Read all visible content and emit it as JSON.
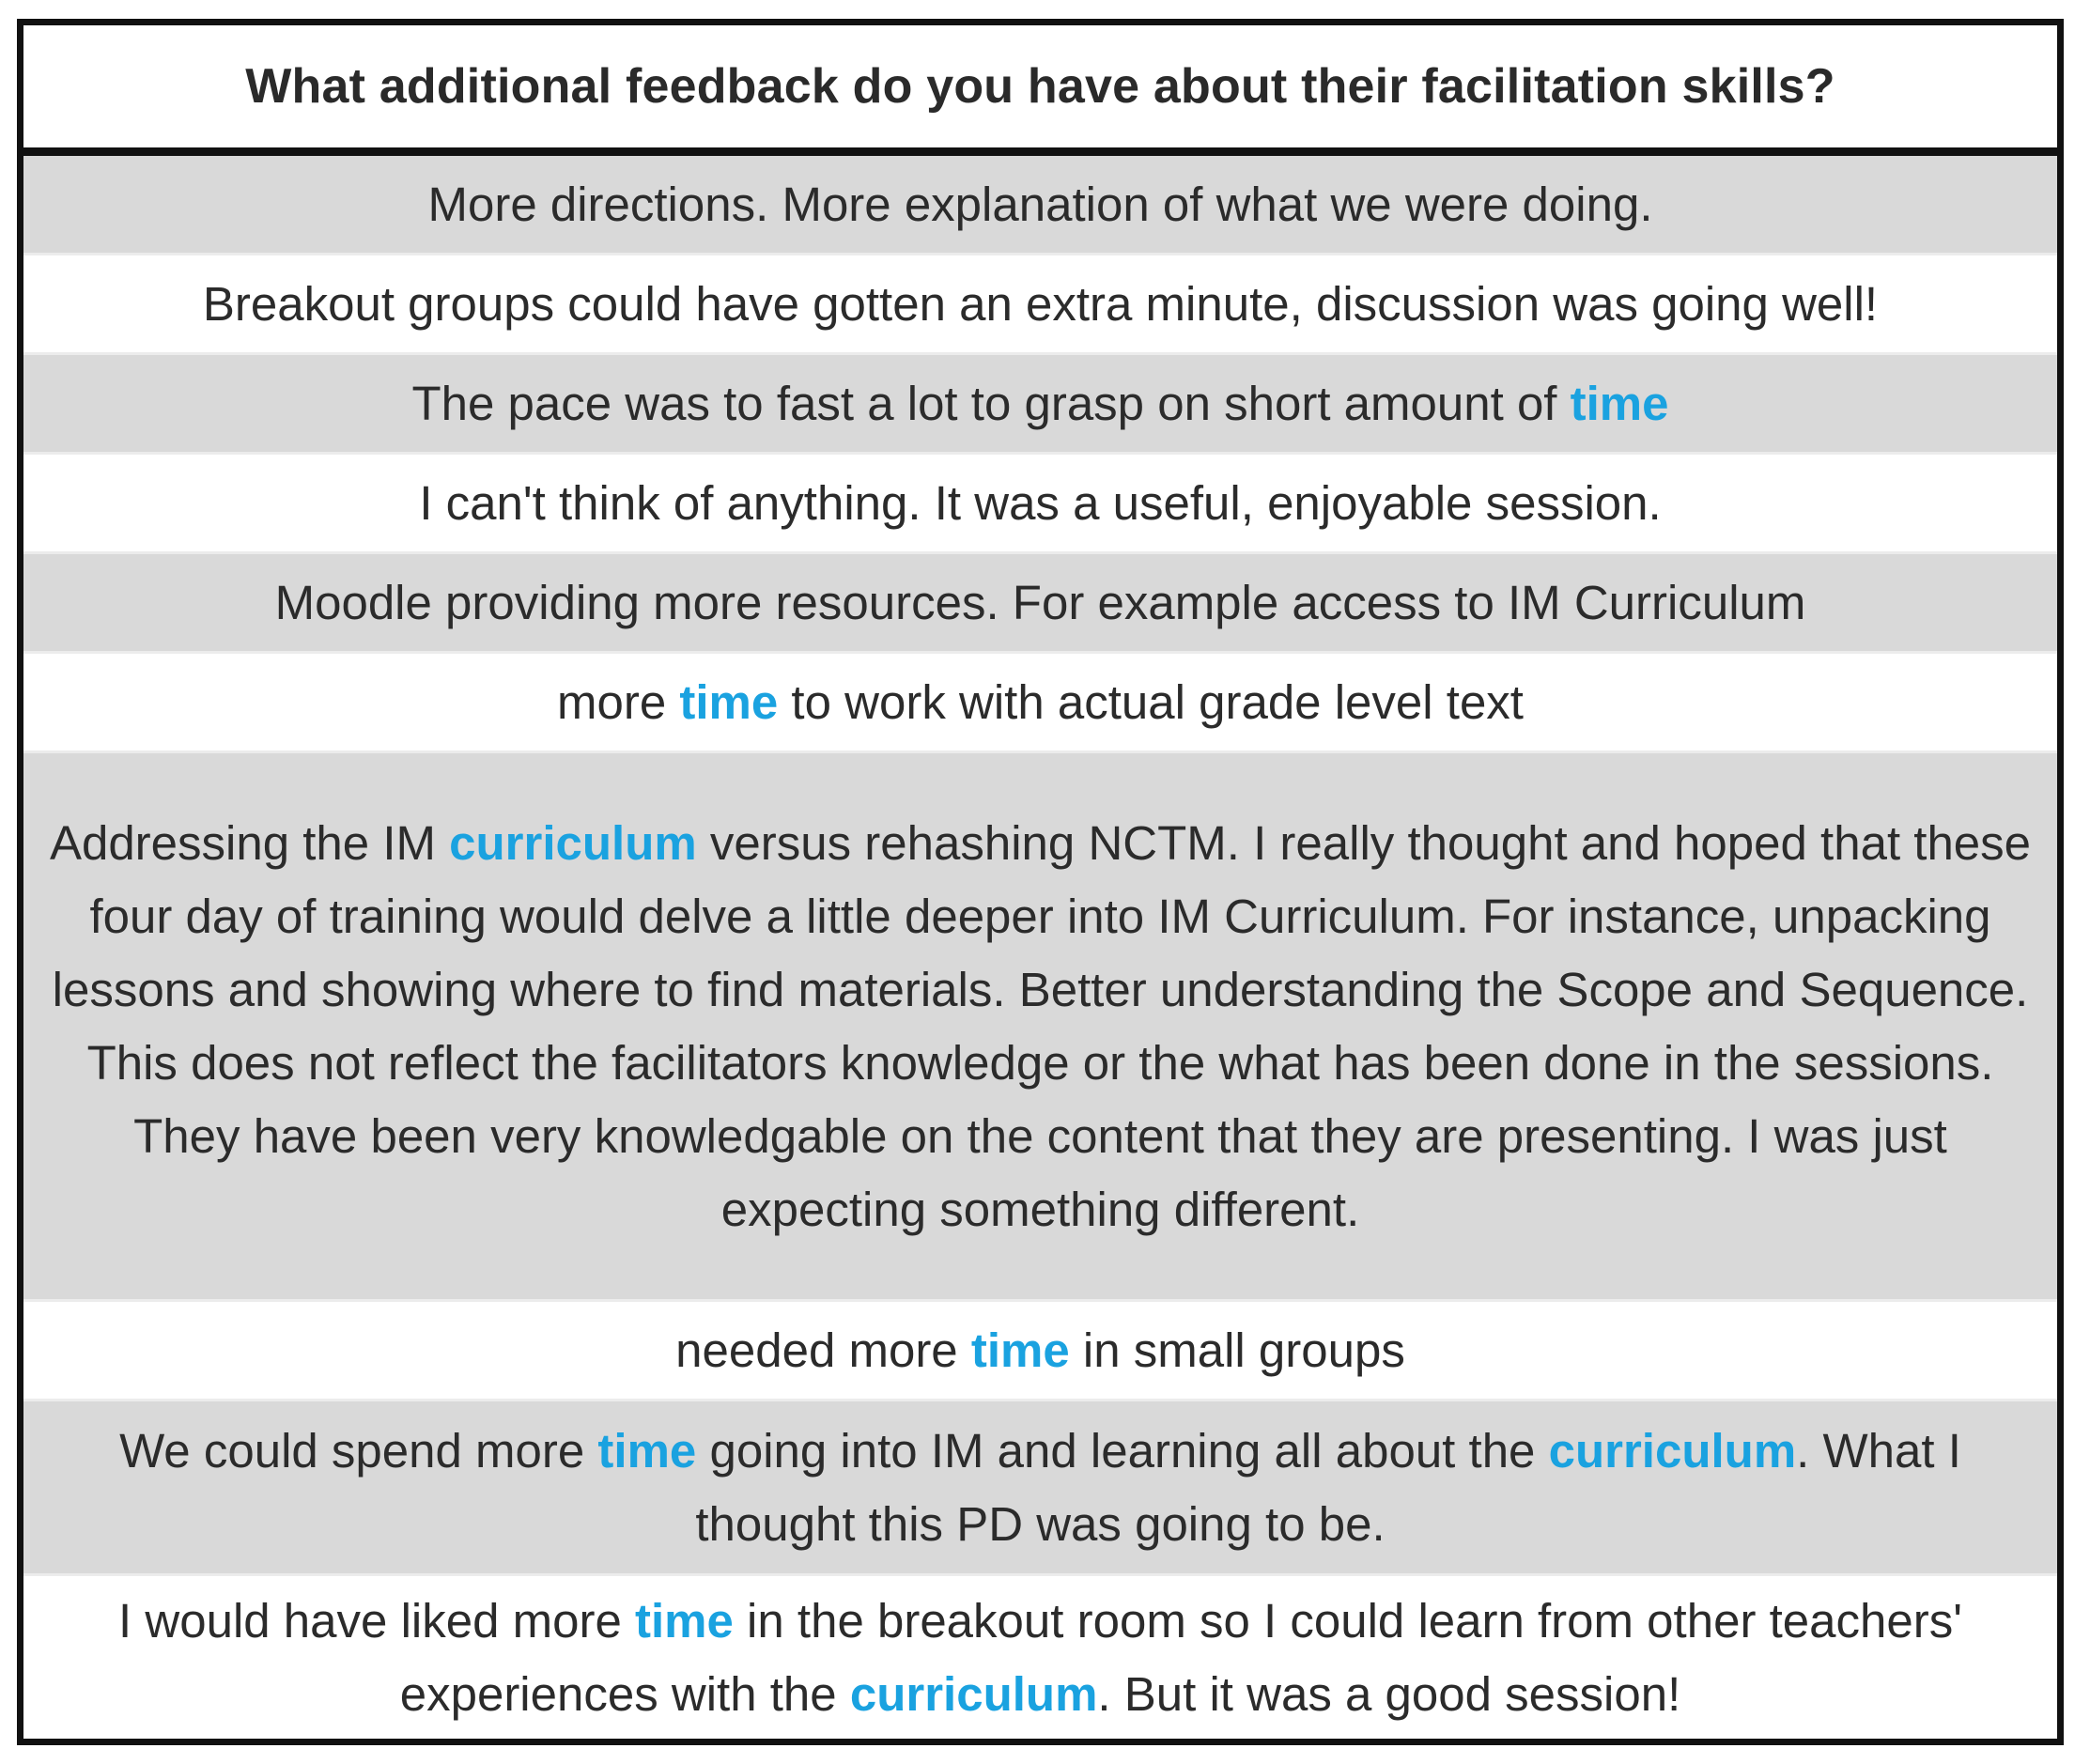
{
  "table": {
    "question": "What additional feedback do you have about their facilitation skills?",
    "keyword_color": "#1aa2e0",
    "rows": [
      {
        "segments": [
          {
            "text": "More directions. More explanation of what we were doing."
          }
        ]
      },
      {
        "segments": [
          {
            "text": "Breakout groups could have gotten an extra minute, discussion was going well!"
          }
        ]
      },
      {
        "segments": [
          {
            "text": "The pace was to fast a lot to grasp on short amount of "
          },
          {
            "text": "time",
            "highlight": true
          }
        ]
      },
      {
        "segments": [
          {
            "text": "I can't think of anything. It was a useful, enjoyable session."
          }
        ]
      },
      {
        "segments": [
          {
            "text": "Moodle providing more resources. For example access to IM Curriculum"
          }
        ]
      },
      {
        "segments": [
          {
            "text": "more "
          },
          {
            "text": "time",
            "highlight": true
          },
          {
            "text": " to work with actual grade level text"
          }
        ]
      },
      {
        "segments": [
          {
            "text": "Addressing the IM "
          },
          {
            "text": "curriculum",
            "highlight": true
          },
          {
            "text": " versus rehashing NCTM. I really thought and hoped that these four day of training would delve a little deeper into IM Curriculum. For instance, unpacking lessons and showing where to find materials. Better understanding the Scope and Sequence. This does not reflect the facilitators knowledge or the what has been done in the sessions. They have been very knowledgable on the content that they are presenting. I was just expecting something different."
          }
        ]
      },
      {
        "segments": [
          {
            "text": "needed more "
          },
          {
            "text": "time",
            "highlight": true
          },
          {
            "text": " in small groups"
          }
        ]
      },
      {
        "segments": [
          {
            "text": "We could spend more "
          },
          {
            "text": "time",
            "highlight": true
          },
          {
            "text": " going into IM and learning all about the "
          },
          {
            "text": "curriculum",
            "highlight": true
          },
          {
            "text": ". What I thought this PD was going to be."
          }
        ]
      },
      {
        "segments": [
          {
            "text": "I would have liked more "
          },
          {
            "text": "time",
            "highlight": true
          },
          {
            "text": " in the breakout room so I could learn from other teachers' experiences with the "
          },
          {
            "text": "curriculum",
            "highlight": true
          },
          {
            "text": ". But it was a good session!"
          }
        ]
      }
    ]
  }
}
